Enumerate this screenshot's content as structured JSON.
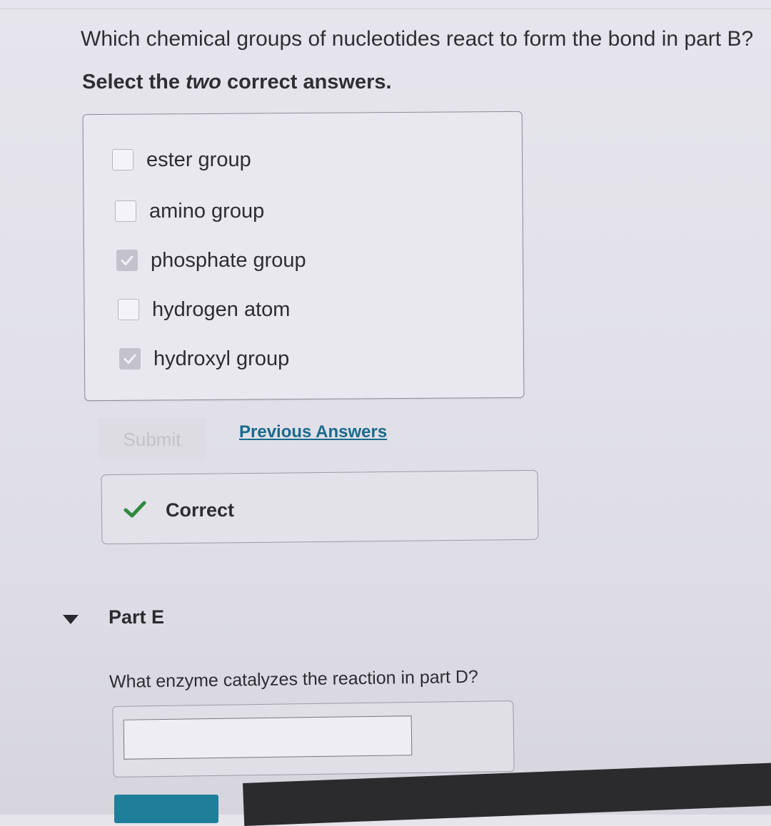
{
  "question": {
    "text": "Which chemical groups of nucleotides react to form the bond in part B?"
  },
  "instruction": {
    "prefix": "Select the ",
    "emphasis": "two",
    "suffix": " correct answers."
  },
  "options": [
    {
      "label": "ester group",
      "checked": false
    },
    {
      "label": "amino group",
      "checked": false
    },
    {
      "label": "phosphate group",
      "checked": true
    },
    {
      "label": "hydrogen atom",
      "checked": false
    },
    {
      "label": "hydroxyl group",
      "checked": true
    }
  ],
  "actions": {
    "submit_label": "Submit",
    "previous_answers_label": "Previous Answers"
  },
  "feedback": {
    "text": "Correct",
    "icon": "checkmark-icon",
    "color": "#2e8b3c"
  },
  "part_e": {
    "title": "Part E",
    "question": "What enzyme catalyzes the reaction in part D?",
    "answer_value": ""
  },
  "colors": {
    "link": "#1a6a8c",
    "primary_button": "#1f7e99"
  }
}
